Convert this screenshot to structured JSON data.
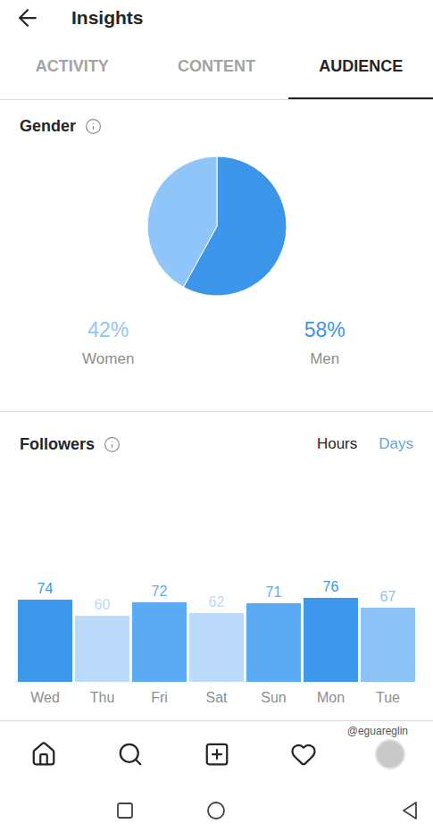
{
  "header": {
    "title": "Insights"
  },
  "tabs": [
    {
      "label": "ACTIVITY",
      "selected": false
    },
    {
      "label": "CONTENT",
      "selected": false
    },
    {
      "label": "AUDIENCE",
      "selected": true
    }
  ],
  "gender": {
    "title": "Gender",
    "segments": [
      {
        "label": "Women",
        "value": "42%",
        "share": 0.42,
        "color": "#8fc5f8"
      },
      {
        "label": "Men",
        "value": "58%",
        "share": 0.58,
        "color": "#3b96ea"
      }
    ]
  },
  "followers": {
    "title": "Followers",
    "toggle": [
      {
        "label": "Hours",
        "selected": false
      },
      {
        "label": "Days",
        "selected": true
      }
    ],
    "chart": {
      "days": [
        "Wed",
        "Thu",
        "Fri",
        "Sat",
        "Sun",
        "Mon",
        "Tue"
      ],
      "values": [
        74,
        60,
        72,
        62,
        71,
        76,
        67
      ],
      "labels": [
        "74",
        "60",
        "72",
        "62",
        "71",
        "76",
        "67"
      ],
      "colors": [
        "#3d97ea",
        "#bcdaf9",
        "#5aabf4",
        "#bcdaf9",
        "#5aabf4",
        "#3d97ea",
        "#8cc3f7"
      ]
    }
  },
  "watermark": "@eguareglin"
}
